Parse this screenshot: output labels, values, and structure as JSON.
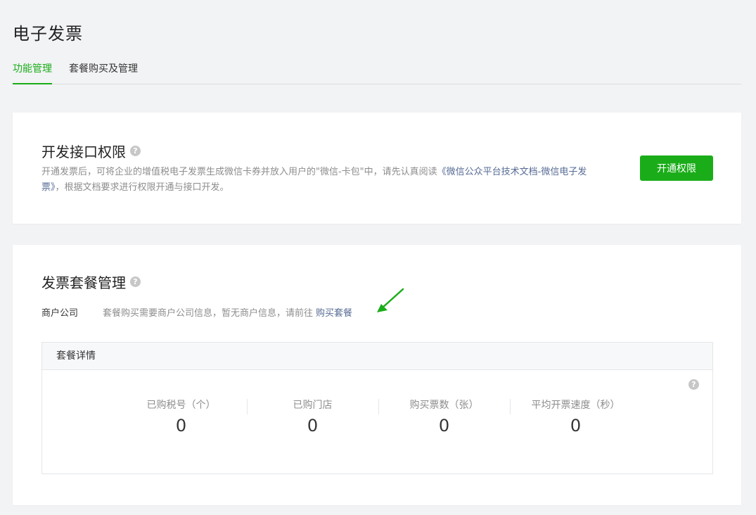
{
  "page": {
    "title": "电子发票"
  },
  "tabs": [
    {
      "label": "功能管理"
    },
    {
      "label": "套餐购买及管理"
    }
  ],
  "api_section": {
    "title": "开发接口权限",
    "desc_before": "开通发票后，可将企业的增值税电子发票生成微信卡券并放入用户的\"微信-卡包\"中，请先认真阅读",
    "desc_link": "《微信公众平台技术文档-微信电子发票》",
    "desc_after": "，根据文档要求进行权限开通与接口开发。",
    "button_label": "开通权限"
  },
  "package_section": {
    "title": "发票套餐管理",
    "merchant_label": "商户公司",
    "merchant_text": "套餐购买需要商户公司信息，暂无商户信息，请前往",
    "merchant_link": "购买套餐",
    "detail_title": "套餐详情",
    "stats": [
      {
        "label": "已购税号（个）",
        "value": "0"
      },
      {
        "label": "已购门店",
        "value": "0"
      },
      {
        "label": "购买票数（张）",
        "value": "0"
      },
      {
        "label": "平均开票速度（秒）",
        "value": "0"
      }
    ]
  },
  "colors": {
    "accent": "#1aad19",
    "link": "#576b95",
    "background": "#f2f3f5"
  },
  "icons": {
    "help": "question-circle-icon",
    "annotation": "green-arrow-icon"
  }
}
